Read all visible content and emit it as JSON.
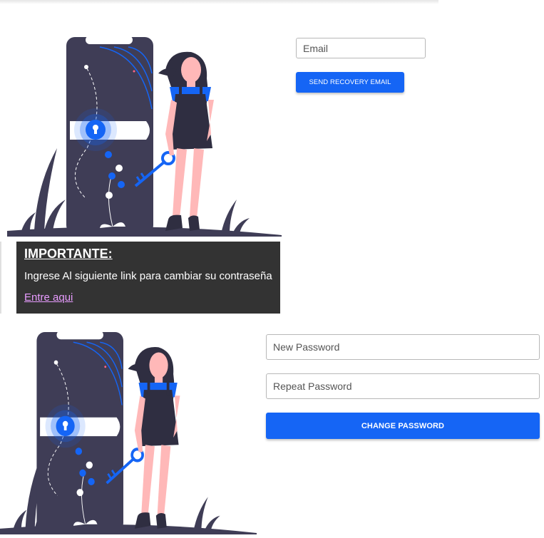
{
  "recovery_form": {
    "email_placeholder": "Email",
    "send_button_label": "SEND RECOVERY EMAIL"
  },
  "notice": {
    "title": "IMPORTANTE:",
    "message": "Ingrese Al siguiente link para cambiar su contraseña",
    "link_text": "Entre aqui"
  },
  "change_form": {
    "new_password_placeholder": "New Password",
    "repeat_password_placeholder": "Repeat Password",
    "change_button_label": "CHANGE PASSWORD"
  },
  "colors": {
    "accent": "#1565f5",
    "phone_dark": "#3f3d56",
    "notice_bg": "#333333",
    "link": "#e89cff",
    "skin": "#ffb8b8"
  },
  "icons": {
    "illustration": "woman-with-key-and-phone-lock-illustration",
    "lock": "keyhole-lock-icon",
    "key": "key-icon"
  }
}
